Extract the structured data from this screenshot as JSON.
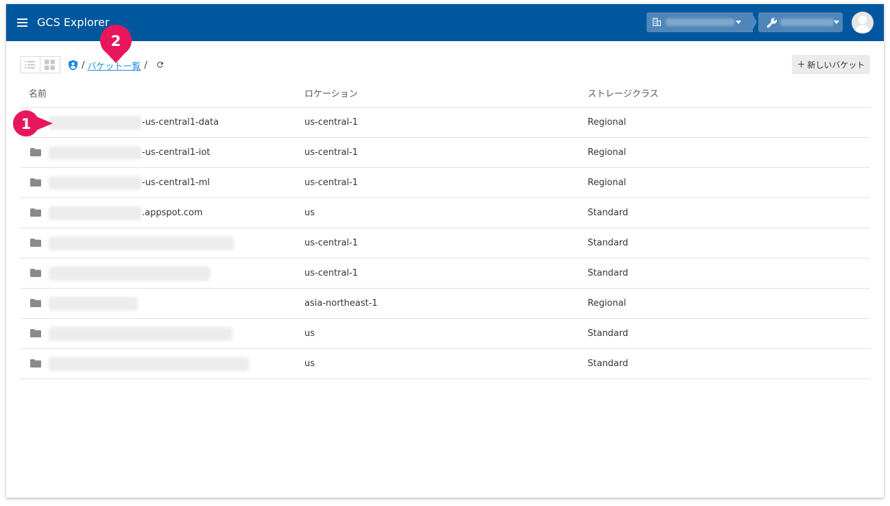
{
  "header": {
    "app_title": "GCS Explorer",
    "menu_icon": "hamburger-menu-icon",
    "org_icon": "building-icon",
    "project_icon": "wrench-icon",
    "avatar_icon": "user-avatar-icon",
    "bar_color": "#00579d"
  },
  "toolbar": {
    "list_view_icon": "list-view-icon",
    "grid_view_icon": "grid-view-icon",
    "breadcrumb_root_icon": "account-shield-icon",
    "breadcrumb_sep": "/",
    "breadcrumb_link": "バケット一覧",
    "refresh_icon": "refresh-icon",
    "new_bucket_plus": "+",
    "new_bucket_label": "新しいバケット"
  },
  "table": {
    "headers": {
      "name": "名前",
      "location": "ロケーション",
      "storage_class": "ストレージクラス"
    },
    "rows": [
      {
        "name_suffix": "-us-central1-data",
        "location": "us-central-1",
        "storage_class": "Regional"
      },
      {
        "name_suffix": "-us-central1-iot",
        "location": "us-central-1",
        "storage_class": "Regional"
      },
      {
        "name_suffix": "-us-central1-ml",
        "location": "us-central-1",
        "storage_class": "Regional"
      },
      {
        "name_suffix": ".appspot.com",
        "location": "us",
        "storage_class": "Standard"
      },
      {
        "name_suffix": "",
        "location": "us-central-1",
        "storage_class": "Standard"
      },
      {
        "name_suffix": "",
        "location": "us-central-1",
        "storage_class": "Standard"
      },
      {
        "name_suffix": "",
        "location": "asia-northeast-1",
        "storage_class": "Regional"
      },
      {
        "name_suffix": "",
        "location": "us",
        "storage_class": "Standard"
      },
      {
        "name_suffix": "",
        "location": "us",
        "storage_class": "Standard"
      }
    ]
  },
  "callouts": {
    "first": "1",
    "second": "2",
    "color": "#e8175d"
  }
}
